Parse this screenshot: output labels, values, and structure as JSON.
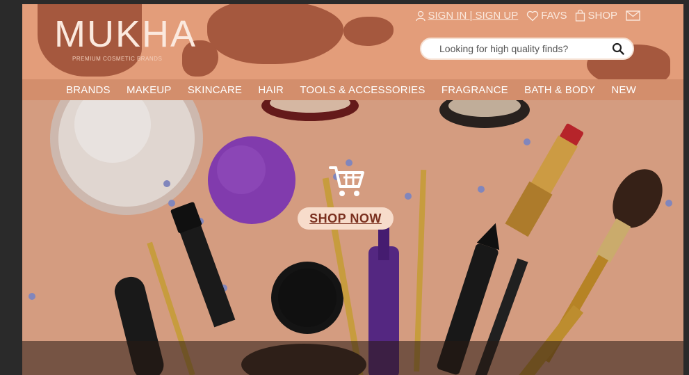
{
  "brand": {
    "name": "MUKHA",
    "tagline": "PREMIUM COSMETIC BRANDS"
  },
  "top_links": {
    "signin": "SIGN IN | SIGN UP",
    "favs": "FAVS",
    "shop": "SHOP"
  },
  "search": {
    "placeholder": "Looking for high quality finds?"
  },
  "nav": {
    "items": [
      "BRANDS",
      "MAKEUP",
      "SKINCARE",
      "HAIR",
      "TOOLS & ACCESSORIES",
      "FRAGRANCE",
      "BATH & BODY",
      "NEW"
    ]
  },
  "hero": {
    "cta": "SHOP NOW"
  },
  "colors": {
    "header": "#e39d7a",
    "blob": "#a5583e",
    "nav": "#d38e6c",
    "cta_bg": "#f7dccb",
    "cta_text": "#7a2f1e"
  },
  "icons": {
    "user": "user-icon",
    "heart": "heart-icon",
    "bag": "shopping-bag-icon",
    "mail": "mail-icon",
    "search": "search-icon",
    "cart": "cart-icon"
  }
}
